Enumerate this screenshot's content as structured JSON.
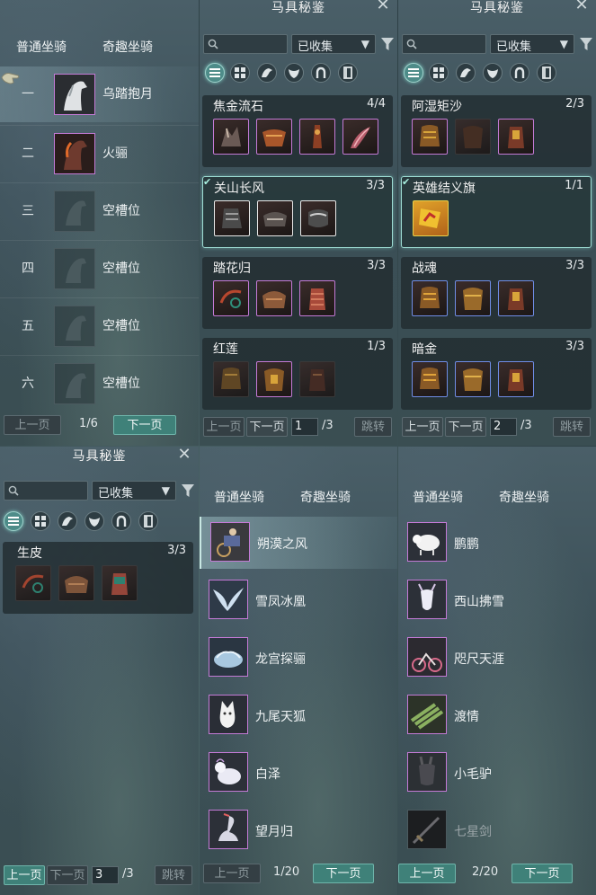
{
  "archive_title": "马具秘鉴",
  "filter": {
    "search_placeholder": "",
    "select_value": "已收集"
  },
  "tabs": {
    "normal": "普通坐骑",
    "fun": "奇趣坐骑"
  },
  "slot_panel": {
    "rows": [
      {
        "num": "一",
        "name": "乌踏抱月"
      },
      {
        "num": "二",
        "name": "火骊"
      },
      {
        "num": "三",
        "name": "空槽位"
      },
      {
        "num": "四",
        "name": "空槽位"
      },
      {
        "num": "五",
        "name": "空槽位"
      },
      {
        "num": "六",
        "name": "空槽位"
      }
    ],
    "pager": {
      "prev": "上一页",
      "page": "1/6",
      "next": "下一页"
    }
  },
  "archive_panel_2": {
    "cards": [
      {
        "name": "焦金流石",
        "count": "4/4"
      },
      {
        "name": "关山长风",
        "count": "3/3"
      },
      {
        "name": "踏花归",
        "count": "3/3"
      },
      {
        "name": "红莲",
        "count": "1/3"
      }
    ],
    "pager": {
      "prev": "上一页",
      "next": "下一页",
      "page_input": "1",
      "total": "/3",
      "jump": "跳转"
    }
  },
  "archive_panel_3": {
    "cards": [
      {
        "name": "阿湿矩沙",
        "count": "2/3"
      },
      {
        "name": "英雄结义旗",
        "count": "1/1"
      },
      {
        "name": "战魂",
        "count": "3/3"
      },
      {
        "name": "暗金",
        "count": "3/3"
      }
    ],
    "pager": {
      "prev": "上一页",
      "next": "下一页",
      "page_input": "2",
      "total": "/3",
      "jump": "跳转"
    }
  },
  "archive_panel_4": {
    "cards": [
      {
        "name": "生皮",
        "count": "3/3"
      }
    ],
    "pager": {
      "prev": "上一页",
      "next": "下一页",
      "page_input": "3",
      "total": "/3",
      "jump": "跳转"
    }
  },
  "fun_list_1": {
    "items": [
      "朔漠之风",
      "雪凤冰凰",
      "龙宫探骊",
      "九尾天狐",
      "白泽",
      "望月归"
    ],
    "pager": {
      "prev": "上一页",
      "page": "1/20",
      "next": "下一页"
    }
  },
  "fun_list_2": {
    "items": [
      "鹏鹏",
      "西山拂雪",
      "咫尺天涯",
      "渡情",
      "小毛驴",
      "七星剑"
    ],
    "pager": {
      "prev": "上一页",
      "page": "2/20",
      "next": "下一页"
    }
  },
  "colors": {
    "accent_teal": "#3f8179",
    "frame_purple": "#c47ad6",
    "frame_blue": "#6f8de6",
    "frame_white": "#e8e8e8"
  }
}
